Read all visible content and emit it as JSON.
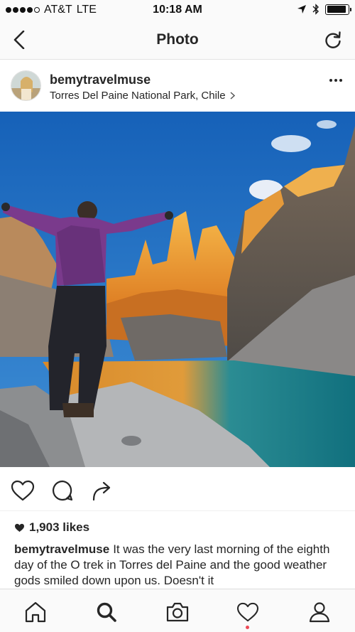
{
  "status_bar": {
    "carrier": "AT&T",
    "network": "LTE",
    "time": "10:18 AM",
    "signal_bars_filled": 4,
    "signal_bars_total": 5,
    "battery_level": 0.9
  },
  "nav": {
    "title": "Photo",
    "back_icon": "chevron-left-icon",
    "refresh_icon": "refresh-icon"
  },
  "post": {
    "username": "bemytravelmuse",
    "location": "Torres Del Paine National Park, Chile",
    "likes": "1,903 likes",
    "caption_username": "bemytravelmuse",
    "caption_text": "It was the very last morning of the eighth day of the O trek in Torres del Paine and the good weather gods smiled down upon us. Doesn't it"
  },
  "actions": {
    "like_icon": "heart-outline-icon",
    "comment_icon": "comment-bubble-icon",
    "share_icon": "share-arrow-icon"
  },
  "tab_bar": {
    "items": [
      "home-icon",
      "search-icon",
      "camera-icon",
      "activity-heart-icon",
      "profile-icon"
    ],
    "active": "search-icon",
    "notification_color": "#ed4956"
  },
  "colors": {
    "text": "#262626",
    "background": "#ffffff",
    "bar_background": "#fafafa"
  }
}
